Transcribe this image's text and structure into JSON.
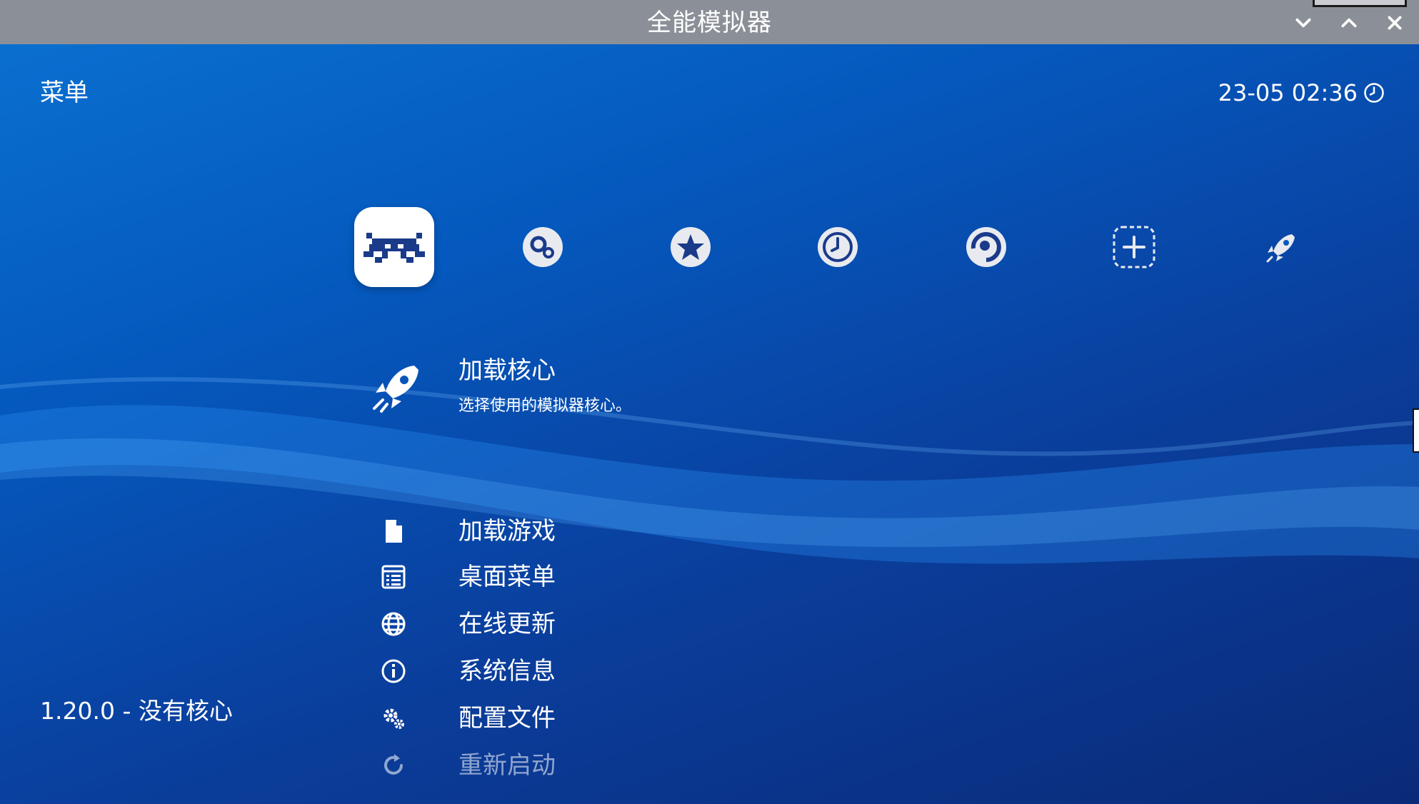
{
  "window": {
    "title": "全能模拟器",
    "controls": [
      "chevron-down-icon",
      "chevron-up-icon",
      "close-icon"
    ]
  },
  "header": {
    "menu_title": "菜单",
    "clock": "23-05 02:36"
  },
  "tabs": [
    {
      "icon": "retroarch-invader-icon",
      "selected": true
    },
    {
      "icon": "settings-gears-icon"
    },
    {
      "icon": "favorites-star-icon"
    },
    {
      "icon": "history-clock-icon"
    },
    {
      "icon": "netplay-icon"
    },
    {
      "icon": "add-content-icon"
    },
    {
      "icon": "core-rocket-icon"
    }
  ],
  "featured": {
    "icon": "rocket-icon",
    "title": "加载核心",
    "subtitle": "选择使用的模拟器核心。"
  },
  "menu_items": [
    {
      "icon": "file-icon",
      "label": "加载游戏"
    },
    {
      "icon": "list-icon",
      "label": "桌面菜单"
    },
    {
      "icon": "globe-icon",
      "label": "在线更新"
    },
    {
      "icon": "info-icon",
      "label": "系统信息"
    },
    {
      "icon": "gears-icon",
      "label": "配置文件"
    },
    {
      "icon": "restart-icon",
      "label": "重新启动",
      "disabled": true
    }
  ],
  "footer": {
    "version": "1.20.0 - 没有核心"
  },
  "colors": {
    "titlebar": "#8b9098",
    "background_top": "#0a6fd0",
    "background_bottom": "#0a2a78",
    "text": "#ffffff"
  }
}
